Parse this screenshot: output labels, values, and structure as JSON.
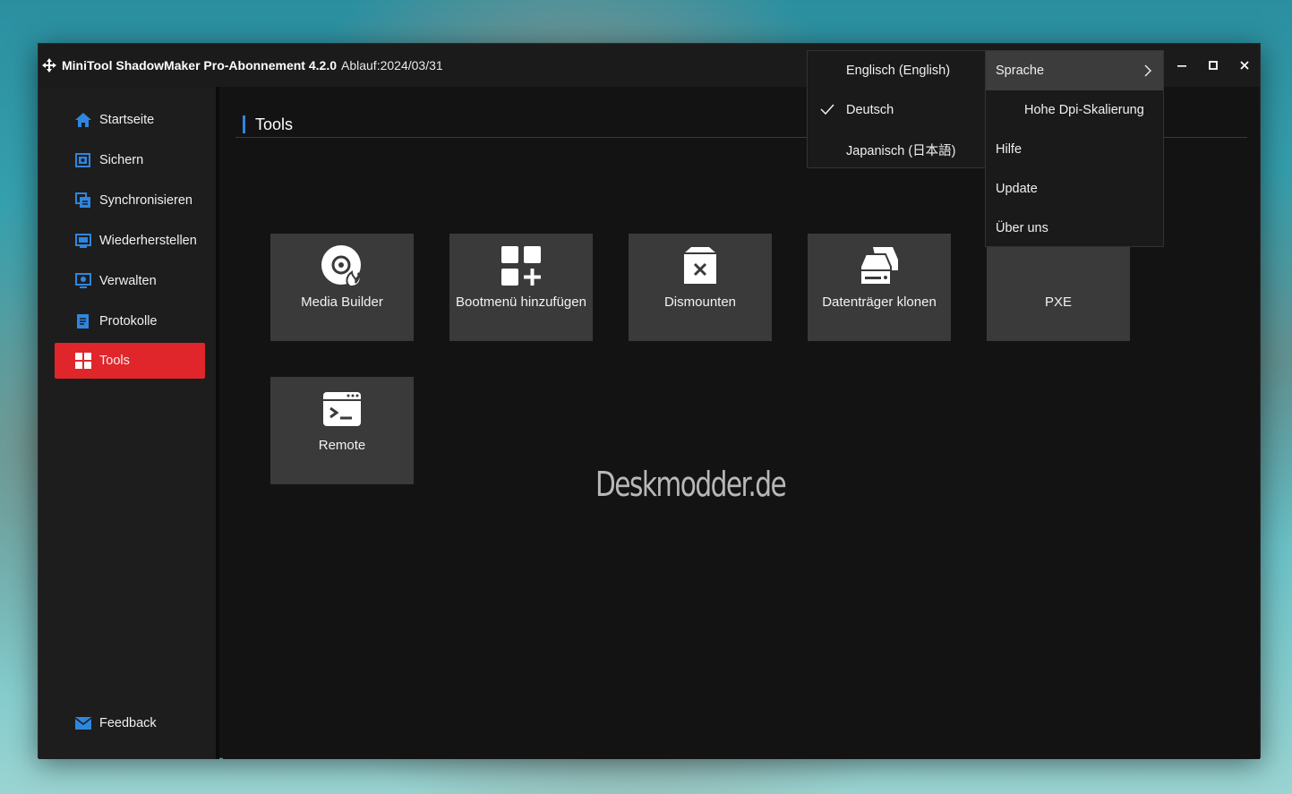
{
  "titlebar": {
    "app_name": "MiniTool ShadowMaker Pro-Abonnement 4.2.0",
    "expiry": "Ablauf:2024/03/31",
    "minimize": "–",
    "maximize": "□",
    "close": "✕"
  },
  "sidebar": {
    "items": [
      {
        "label": "Startseite",
        "icon": "home-icon"
      },
      {
        "label": "Sichern",
        "icon": "backup-icon"
      },
      {
        "label": "Synchronisieren",
        "icon": "sync-icon"
      },
      {
        "label": "Wiederherstellen",
        "icon": "restore-icon"
      },
      {
        "label": "Verwalten",
        "icon": "manage-icon"
      },
      {
        "label": "Protokolle",
        "icon": "logs-icon"
      },
      {
        "label": "Tools",
        "icon": "tools-icon",
        "active": true
      }
    ],
    "feedback": "Feedback"
  },
  "main": {
    "title": "Tools",
    "tiles": [
      {
        "label": "Media Builder",
        "icon": "disc-flame-icon"
      },
      {
        "label": "Bootmenü hinzufügen",
        "icon": "grid-add-icon"
      },
      {
        "label": "Dismounten",
        "icon": "unmount-icon"
      },
      {
        "label": "Datenträger klonen",
        "icon": "disk-clone-icon"
      },
      {
        "label": "PXE",
        "icon": "pxe-icon"
      },
      {
        "label": "Remote",
        "icon": "terminal-icon"
      }
    ],
    "watermark": "Deskmodder.de"
  },
  "language_menu": {
    "items": [
      {
        "label": "Englisch (English)",
        "checked": false
      },
      {
        "label": "Deutsch",
        "checked": true
      },
      {
        "label": "Japanisch (日本語)",
        "checked": false
      }
    ]
  },
  "main_menu": {
    "items": [
      {
        "label": "Sprache",
        "submenu": true,
        "highlighted": true
      },
      {
        "label": "Hohe Dpi-Skalierung"
      },
      {
        "label": "Hilfe"
      },
      {
        "label": "Update"
      },
      {
        "label": "Über uns"
      }
    ]
  },
  "colors": {
    "accent_red": "#e0262b",
    "accent_blue": "#2e86de",
    "tile_bg": "#3a3a3a"
  }
}
